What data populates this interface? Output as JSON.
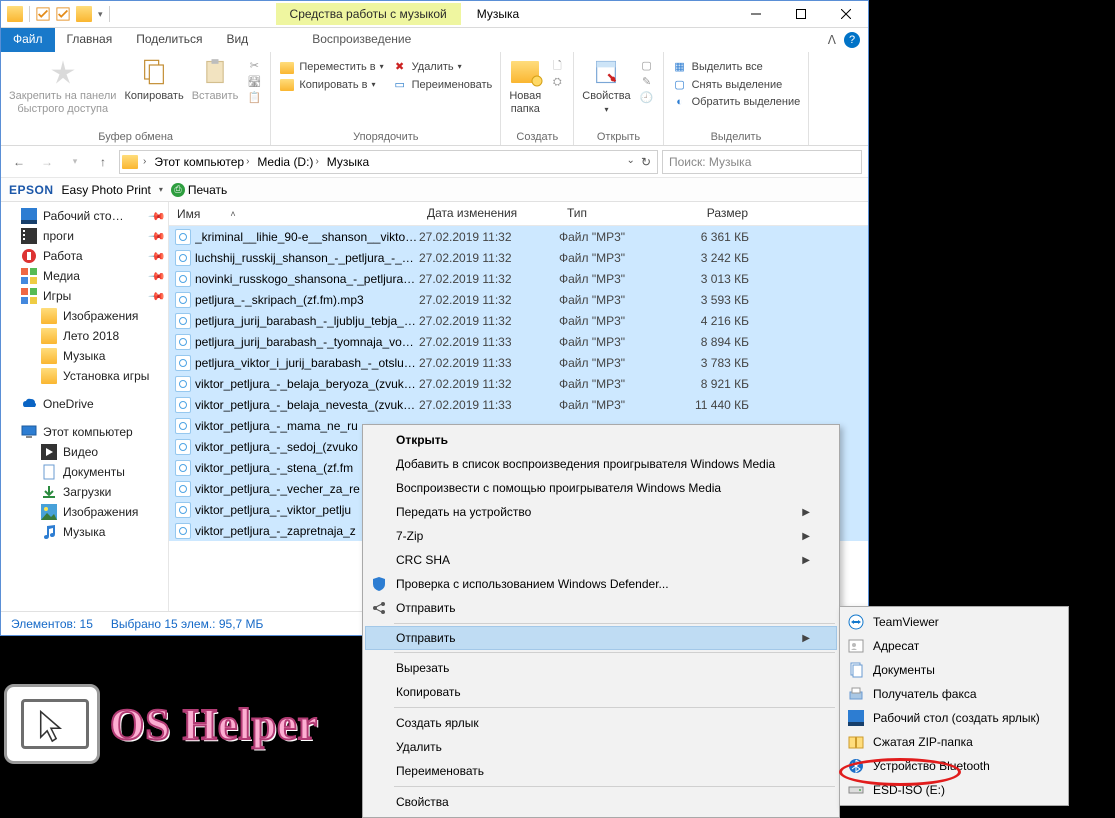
{
  "window": {
    "title": "Музыка"
  },
  "musicTools": {
    "contextTab": "Средства работы с музыкой",
    "subTab": "Воспроизведение"
  },
  "ribbonTabs": {
    "file": "Файл",
    "home": "Главная",
    "share": "Поделиться",
    "view": "Вид"
  },
  "ribbon": {
    "clipboard": {
      "label": "Буфер обмена",
      "pin": "Закрепить на панели\nбыстрого доступа",
      "copy": "Копировать",
      "paste": "Вставить"
    },
    "organize": {
      "label": "Упорядочить",
      "moveTo": "Переместить в",
      "copyTo": "Копировать в",
      "delete": "Удалить",
      "rename": "Переименовать"
    },
    "new": {
      "label": "Создать",
      "newFolder": "Новая\nпапка"
    },
    "open": {
      "label": "Открыть",
      "properties": "Свойства"
    },
    "select": {
      "label": "Выделить",
      "selectAll": "Выделить все",
      "selectNone": "Снять выделение",
      "invert": "Обратить выделение"
    }
  },
  "breadcrumb": {
    "thisPC": "Этот компьютер",
    "drive": "Media (D:)",
    "folder": "Музыка"
  },
  "search": {
    "placeholder": "Поиск: Музыка"
  },
  "epson": {
    "brand": "EPSON",
    "app": "Easy Photo Print",
    "print": "Печать"
  },
  "navPane": {
    "desktop": "Рабочий сто…",
    "progi": "проги",
    "work": "Работа",
    "media": "Медиа",
    "games": "Игры",
    "images": "Изображения",
    "summer": "Лето 2018",
    "music": "Музыка",
    "install": "Установка игры",
    "onedrive": "OneDrive",
    "thispc": "Этот компьютер",
    "videos": "Видео",
    "documents": "Документы",
    "downloads": "Загрузки",
    "images2": "Изображения",
    "music2": "Музыка"
  },
  "columns": {
    "name": "Имя",
    "date": "Дата изменения",
    "type": "Тип",
    "size": "Размер"
  },
  "files": [
    {
      "name": "_kriminal__lihie_90-e__shanson__viktor_p...",
      "date": "27.02.2019 11:32",
      "type": "Файл \"MP3\"",
      "size": "6 361 КБ",
      "sel": true
    },
    {
      "name": "luchshij_russkij_shanson_-_petljura_-_pla...",
      "date": "27.02.2019 11:32",
      "type": "Файл \"MP3\"",
      "size": "3 242 КБ",
      "sel": true
    },
    {
      "name": "novinki_russkogo_shansona_-_petljura_ju...",
      "date": "27.02.2019 11:32",
      "type": "Файл \"MP3\"",
      "size": "3 013 КБ",
      "sel": true
    },
    {
      "name": "petljura_-_skripach_(zf.fm).mp3",
      "date": "27.02.2019 11:32",
      "type": "Файл \"MP3\"",
      "size": "3 593 КБ",
      "sel": true
    },
    {
      "name": "petljura_jurij_barabash_-_ljublju_tebja_(zv...",
      "date": "27.02.2019 11:32",
      "type": "Файл \"MP3\"",
      "size": "4 216 КБ",
      "sel": true
    },
    {
      "name": "petljura_jurij_barabash_-_tyomnaja_voda...",
      "date": "27.02.2019 11:33",
      "type": "Файл \"MP3\"",
      "size": "8 894 КБ",
      "sel": true
    },
    {
      "name": "petljura_viktor_i_jurij_barabash_-_otsluzhi...",
      "date": "27.02.2019 11:33",
      "type": "Файл \"MP3\"",
      "size": "3 783 КБ",
      "sel": true
    },
    {
      "name": "viktor_petljura_-_belaja_beryoza_(zvukoff...",
      "date": "27.02.2019 11:32",
      "type": "Файл \"MP3\"",
      "size": "8 921 КБ",
      "sel": true
    },
    {
      "name": "viktor_petljura_-_belaja_nevesta_(zvukoff...",
      "date": "27.02.2019 11:33",
      "type": "Файл \"MP3\"",
      "size": "11 440 КБ",
      "sel": true
    },
    {
      "name": "viktor_petljura_-_mama_ne_ru",
      "date": "",
      "type": "",
      "size": "",
      "sel": true
    },
    {
      "name": "viktor_petljura_-_sedoj_(zvuko",
      "date": "",
      "type": "",
      "size": "",
      "sel": true
    },
    {
      "name": "viktor_petljura_-_stena_(zf.fm",
      "date": "",
      "type": "",
      "size": "",
      "sel": true
    },
    {
      "name": "viktor_petljura_-_vecher_za_re",
      "date": "",
      "type": "",
      "size": "",
      "sel": true
    },
    {
      "name": "viktor_petljura_-_viktor_petlju",
      "date": "",
      "type": "",
      "size": "",
      "sel": true
    },
    {
      "name": "viktor_petljura_-_zapretnaja_z",
      "date": "",
      "type": "",
      "size": "",
      "sel": true
    }
  ],
  "status": {
    "items": "Элементов: 15",
    "selected": "Выбрано 15 элем.: 95,7 МБ"
  },
  "ctx": {
    "open": "Открыть",
    "addToWMP": "Добавить в список воспроизведения проигрывателя Windows Media",
    "playWMP": "Воспроизвести с помощью проигрывателя Windows Media",
    "castTo": "Передать на устройство",
    "sevenZip": "7-Zip",
    "crcSha": "CRC SHA",
    "defender": "Проверка с использованием Windows Defender...",
    "share": "Отправить",
    "sendTo": "Отправить",
    "cut": "Вырезать",
    "copy": "Копировать",
    "shortcut": "Создать ярлык",
    "delete": "Удалить",
    "rename": "Переименовать",
    "properties": "Свойства"
  },
  "sendTo": {
    "teamviewer": "TeamViewer",
    "recipient": "Адресат",
    "documents": "Документы",
    "fax": "Получатель факса",
    "desktop": "Рабочий стол (создать ярлык)",
    "zip": "Сжатая ZIP-папка",
    "bluetooth": "Устройство Bluetooth",
    "esdiso": "ESD-ISO (E:)"
  },
  "oshelper": "OS Helper"
}
